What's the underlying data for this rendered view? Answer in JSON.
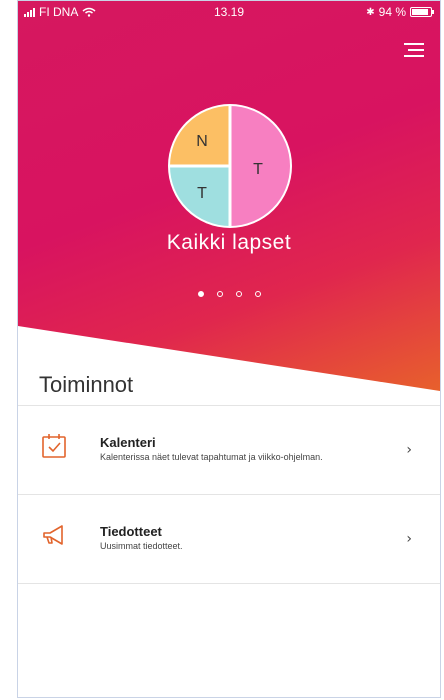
{
  "status_bar": {
    "carrier": "FI DNA",
    "time": "13.19",
    "battery": "94 %",
    "bluetooth": "✱"
  },
  "child": {
    "name": "Kaikki lapset",
    "avatar_segments": [
      {
        "letter": "N",
        "color": "#fcbf64"
      },
      {
        "letter": "T",
        "color": "#f77fc1"
      },
      {
        "letter": "T",
        "color": "#9fdfe0"
      }
    ]
  },
  "pager": {
    "count": 4,
    "active": 0
  },
  "section_title": "Toiminnot",
  "items": [
    {
      "title": "Kalenteri",
      "description": "Kalenterissa näet tulevat tapahtumat ja viikko-ohjelman.",
      "icon": "calendar-icon"
    },
    {
      "title": "Tiedotteet",
      "description": "Uusimmat tiedotteet.",
      "icon": "megaphone-icon"
    }
  ],
  "chevron": "›",
  "colors": {
    "hero_primary": "#d6185f",
    "hero_accent": "#e8642a",
    "icon_orange": "#e2642c"
  }
}
